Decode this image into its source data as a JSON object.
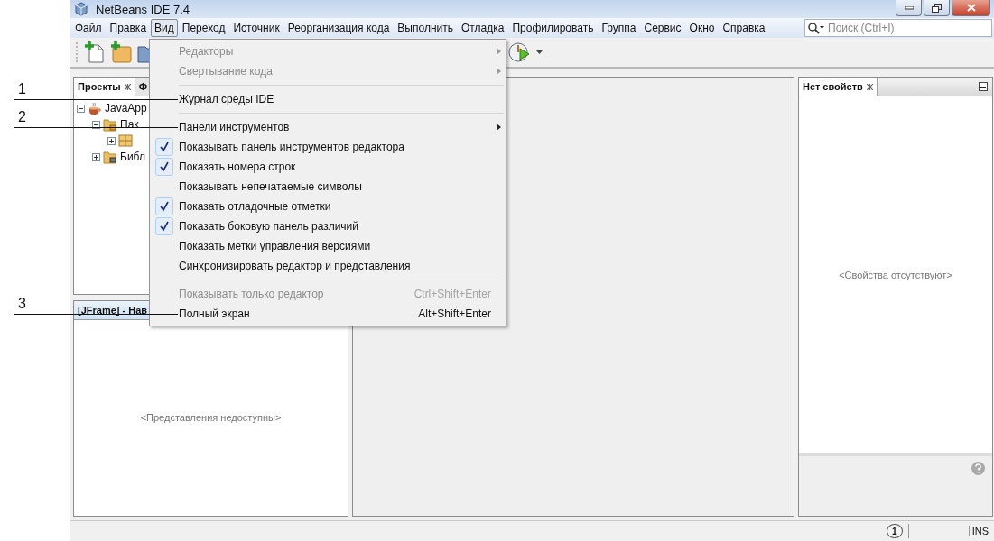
{
  "window": {
    "title": "NetBeans IDE 7.4"
  },
  "menu_bar": [
    {
      "label": "Файл",
      "selected": false
    },
    {
      "label": "Правка",
      "selected": false
    },
    {
      "label": "Вид",
      "selected": true
    },
    {
      "label": "Переход",
      "selected": false
    },
    {
      "label": "Источник",
      "selected": false
    },
    {
      "label": "Реорганизация кода",
      "selected": false
    },
    {
      "label": "Выполнить",
      "selected": false
    },
    {
      "label": "Отладка",
      "selected": false
    },
    {
      "label": "Профилировать",
      "selected": false
    },
    {
      "label": "Группа",
      "selected": false
    },
    {
      "label": "Сервис",
      "selected": false
    },
    {
      "label": "Окно",
      "selected": false
    },
    {
      "label": "Справка",
      "selected": false
    }
  ],
  "search": {
    "placeholder": "Поиск (Ctrl+I)"
  },
  "view_menu": [
    {
      "kind": "submenu",
      "label": "Редакторы",
      "disabled": true
    },
    {
      "kind": "submenu",
      "label": "Свертывание кода",
      "disabled": true
    },
    {
      "kind": "separator"
    },
    {
      "kind": "action",
      "label": "Журнал среды IDE",
      "disabled": false,
      "callout": "1"
    },
    {
      "kind": "separator"
    },
    {
      "kind": "submenu",
      "label": "Панели инструментов",
      "disabled": false,
      "callout": "2"
    },
    {
      "kind": "check",
      "label": "Показывать панель инструментов редактора",
      "checked": true
    },
    {
      "kind": "check",
      "label": "Показать номера строк",
      "checked": true
    },
    {
      "kind": "check",
      "label": "Показывать непечатаемые символы",
      "checked": false
    },
    {
      "kind": "check",
      "label": "Показать отладочные отметки",
      "checked": true
    },
    {
      "kind": "check",
      "label": "Показать боковую панель различий",
      "checked": true
    },
    {
      "kind": "check",
      "label": "Показать метки управления версиями",
      "checked": false
    },
    {
      "kind": "action",
      "label": "Синхронизировать редактор и представления",
      "disabled": false
    },
    {
      "kind": "separator"
    },
    {
      "kind": "action",
      "label": "Показывать только редактор",
      "shortcut": "Ctrl+Shift+Enter",
      "disabled": true
    },
    {
      "kind": "action",
      "label": "Полный экран",
      "shortcut": "Alt+Shift+Enter",
      "disabled": false,
      "callout": "3"
    }
  ],
  "projects_panel": {
    "tabs": [
      {
        "label": "Проекты",
        "selected": true
      },
      {
        "label": "Ф",
        "selected": false
      }
    ],
    "tree": [
      {
        "kind": "project",
        "label": "JavaApp",
        "expanded": true,
        "children": [
          {
            "kind": "source_folder",
            "label": "Пак",
            "expanded": true,
            "children": [
              {
                "kind": "package",
                "expanded": false
              }
            ]
          },
          {
            "kind": "library",
            "label": "Библ",
            "expanded": false
          }
        ]
      }
    ]
  },
  "navigator_panel": {
    "tab": "[JFrame] - Нав",
    "message": "<Представления недоступны>"
  },
  "properties_panel": {
    "tab": "Нет свойств",
    "message": "<Свойства отсутствуют>"
  },
  "status_bar": {
    "notifications": "1",
    "mode": "INS"
  }
}
